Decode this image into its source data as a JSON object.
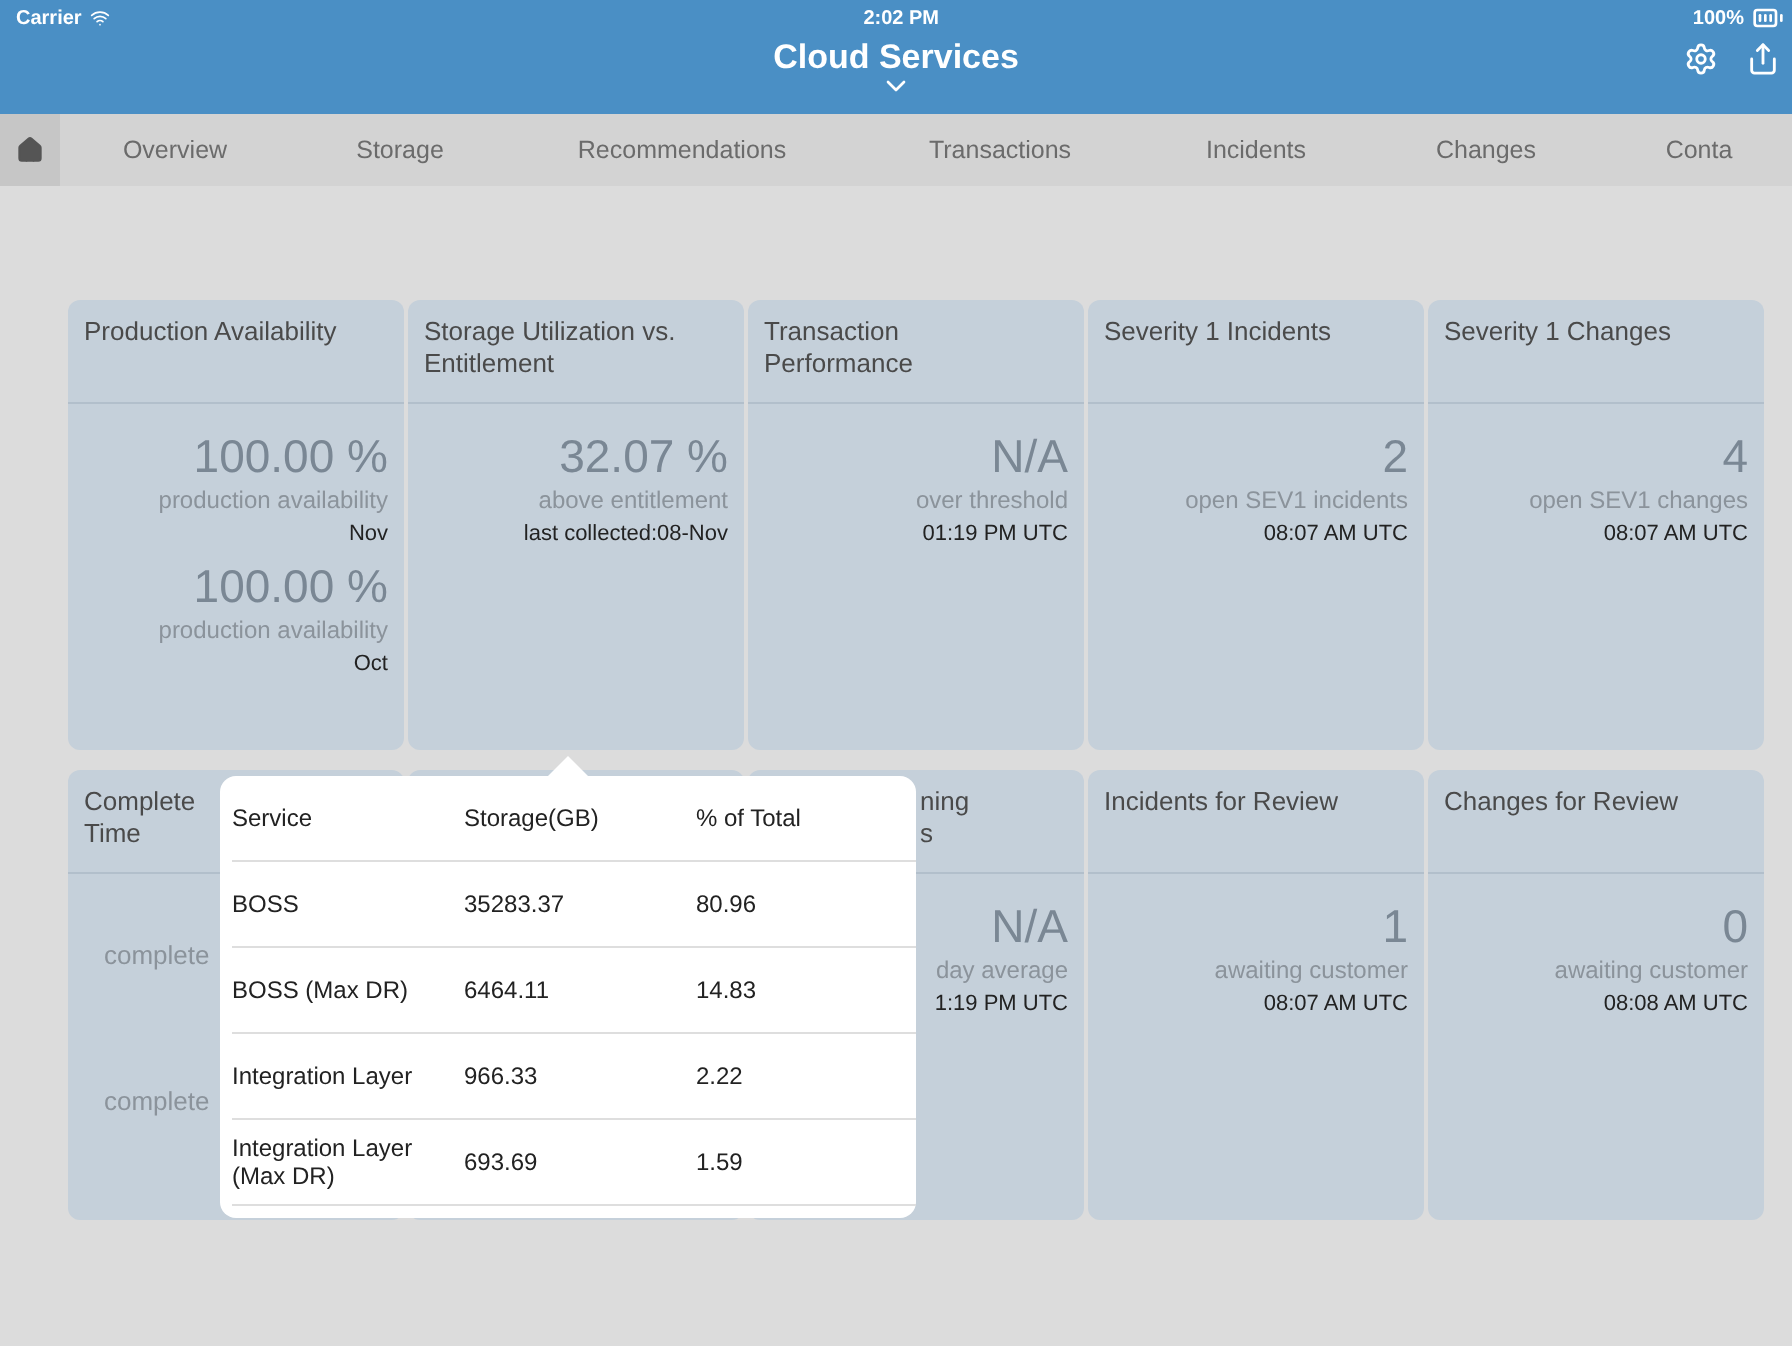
{
  "status_bar": {
    "carrier": "Carrier",
    "time": "2:02 PM",
    "battery": "100%"
  },
  "header": {
    "title": "Cloud Services"
  },
  "tabs": [
    {
      "kind": "home",
      "selected": true
    },
    {
      "label": "Overview",
      "selected": false
    },
    {
      "label": "Storage",
      "selected": false
    },
    {
      "label": "Recommendations",
      "selected": false
    },
    {
      "label": "Transactions",
      "selected": false
    },
    {
      "label": "Incidents",
      "selected": false
    },
    {
      "label": "Changes",
      "selected": false
    },
    {
      "label": "Conta",
      "selected": false
    }
  ],
  "top_cards": [
    {
      "title": "Production Availability",
      "metrics": [
        {
          "value": "100.00 %",
          "label": "production availability",
          "note": "Nov"
        },
        {
          "value": "100.00 %",
          "label": "production availability",
          "note": "Oct"
        }
      ]
    },
    {
      "title": "Storage Utilization vs. Entitlement",
      "metrics": [
        {
          "value": "32.07 %",
          "label": "above entitlement",
          "note": "last collected:08-Nov"
        }
      ]
    },
    {
      "title": "Transaction Performance",
      "metrics": [
        {
          "value": "N/A",
          "label": "over threshold",
          "note": "01:19 PM UTC"
        }
      ]
    },
    {
      "title": "Severity 1 Incidents",
      "metrics": [
        {
          "value": "2",
          "label": "open SEV1 incidents",
          "note": "08:07 AM UTC"
        }
      ]
    },
    {
      "title": "Severity 1 Changes",
      "metrics": [
        {
          "value": "4",
          "label": "open SEV1 changes",
          "note": "08:07 AM UTC"
        }
      ]
    }
  ],
  "bottom_cards": [
    {
      "kind": "cut_right",
      "title_lines": [
        "Complete",
        "Time"
      ],
      "lines": [
        "complete",
        "complete"
      ]
    },
    {
      "kind": "covered"
    },
    {
      "kind": "cut_left",
      "title_lines": [
        "ning",
        "s"
      ],
      "value": "N/A",
      "label": "day average",
      "note": "1:19 PM UTC"
    },
    {
      "kind": "full",
      "title_lines": [
        "Incidents for Review"
      ],
      "value": "1",
      "label": "awaiting customer",
      "note": "08:07 AM UTC"
    },
    {
      "kind": "full",
      "title_lines": [
        "Changes for Review"
      ],
      "value": "0",
      "label": "awaiting customer",
      "note": "08:08 AM UTC"
    }
  ],
  "popover": {
    "columns": [
      "Service",
      "Storage(GB)",
      "% of Total"
    ],
    "rows": [
      [
        "BOSS",
        "35283.37",
        "80.96"
      ],
      [
        "BOSS (Max DR)",
        "6464.11",
        "14.83"
      ],
      [
        "Integration Layer",
        "966.33",
        "2.22"
      ],
      [
        "Integration Layer (Max DR)",
        "693.69",
        "1.59"
      ]
    ]
  }
}
